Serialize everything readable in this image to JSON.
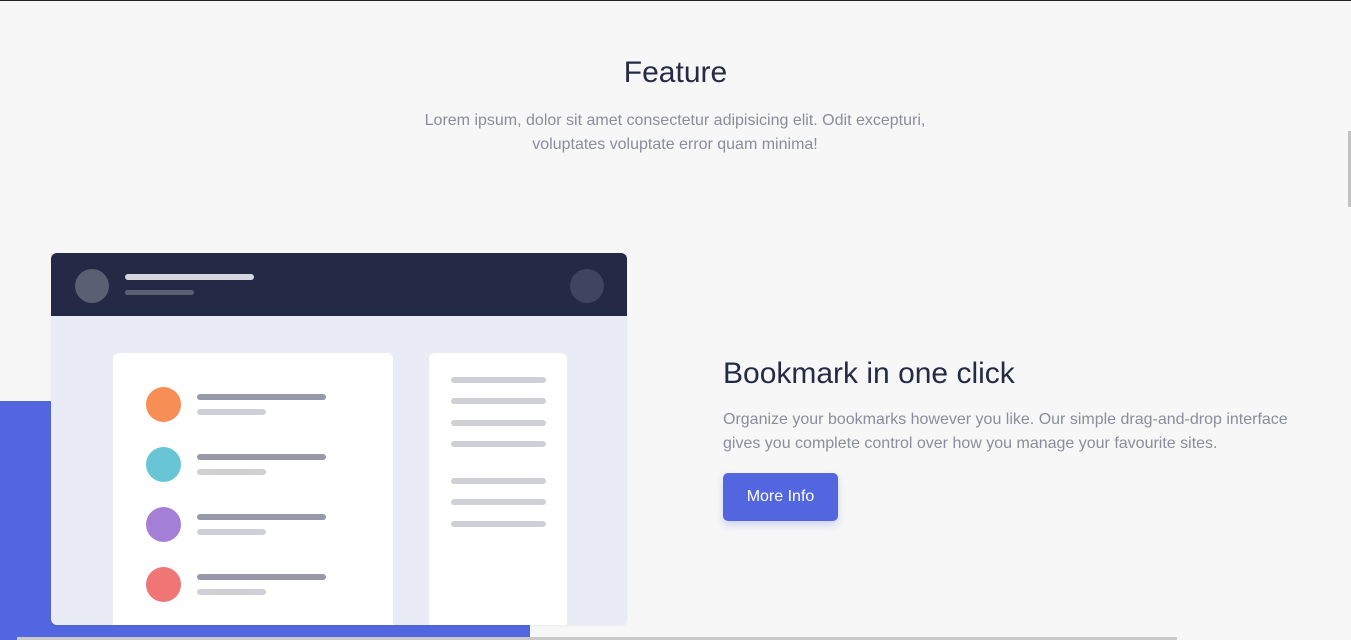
{
  "section": {
    "title": "Feature",
    "description": "Lorem ipsum, dolor sit amet consectetur adipisicing elit. Odit excepturi, voluptates voluptate error quam minima!"
  },
  "feature": {
    "title": "Bookmark in one click",
    "description": "Organize your bookmarks however you like. Our simple drag-and-drop interface gives you complete control over how you manage your favourite sites.",
    "button_label": "More Info"
  },
  "illustration": {
    "list_item_colors": [
      "#f68e56",
      "#67c5d6",
      "#a47fd6",
      "#ef7674"
    ]
  },
  "colors": {
    "accent": "#5267df",
    "dark_navy": "#242a46",
    "text_gray": "#8a8d9b"
  }
}
